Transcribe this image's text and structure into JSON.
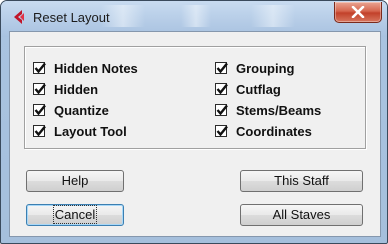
{
  "window": {
    "title": "Reset Layout",
    "close_icon": "close-x-icon",
    "app_icon": "cubase-logo-icon",
    "accent_colors": {
      "titlebar": "#b9d1ea",
      "close_button": "#c2412a",
      "client": "#f0f0f0"
    }
  },
  "options": {
    "left": [
      {
        "label": "Hidden Notes",
        "checked": true
      },
      {
        "label": "Hidden",
        "checked": true
      },
      {
        "label": "Quantize",
        "checked": true
      },
      {
        "label": "Layout Tool",
        "checked": true
      }
    ],
    "right": [
      {
        "label": "Grouping",
        "checked": true
      },
      {
        "label": "Cutflag",
        "checked": true
      },
      {
        "label": "Stems/Beams",
        "checked": true
      },
      {
        "label": "Coordinates",
        "checked": true
      }
    ]
  },
  "buttons": {
    "help": "Help",
    "cancel": "Cancel",
    "this_staff": "This Staff",
    "all_staves": "All Staves"
  }
}
